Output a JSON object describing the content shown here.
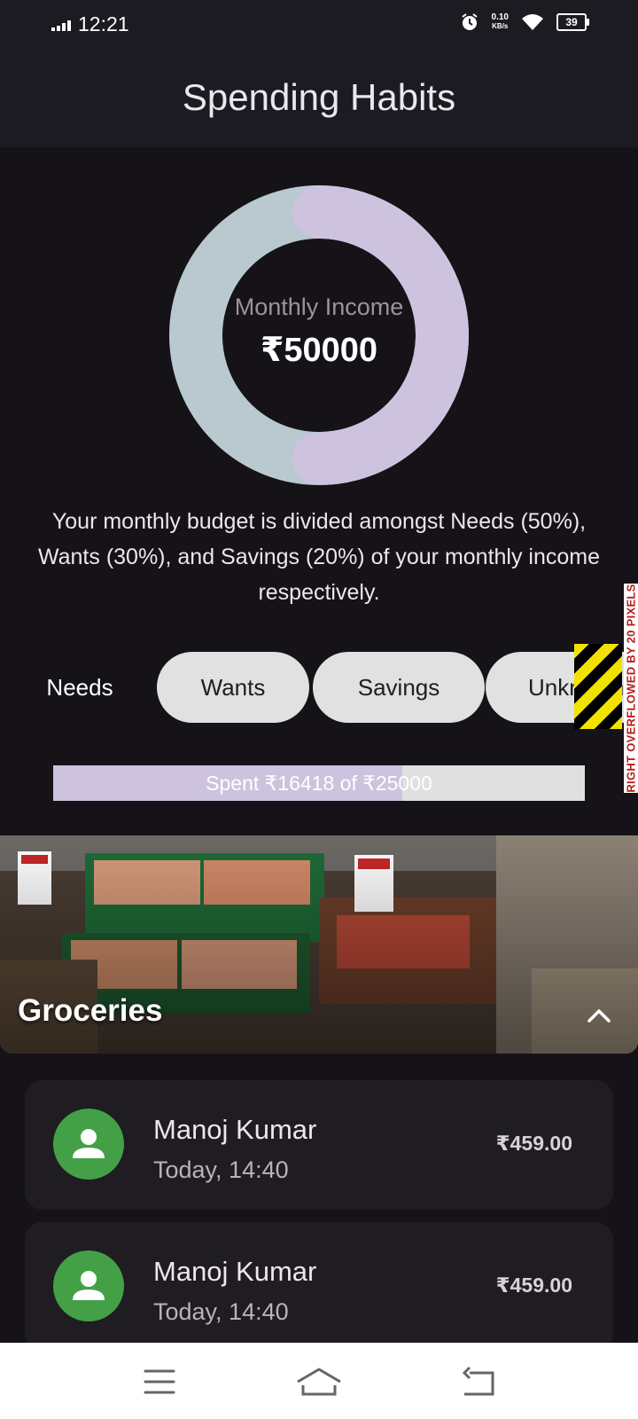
{
  "status_bar": {
    "time": "12:21",
    "net_speed_value": "0.10",
    "net_speed_unit": "KB/s",
    "battery": "39"
  },
  "app_bar": {
    "title": "Spending Habits"
  },
  "income_chart": {
    "label": "Monthly Income",
    "value": "₹50000",
    "segments": [
      {
        "color": "#cdc3de",
        "fraction": 0.5
      },
      {
        "color": "#b9c9cf",
        "fraction": 0.5
      }
    ]
  },
  "budget_description": "Your monthly budget is divided amongst Needs (50%), Wants (30%), and Savings (20%) of your monthly income respectively.",
  "categories": {
    "needs": "Needs",
    "wants": "Wants",
    "savings": "Savings",
    "unknown": "Unknown"
  },
  "overflow_warning": "RIGHT OVERFLOWED BY 20 PIXELS",
  "spend_progress": {
    "text": "Spent ₹16418 of ₹25000",
    "spent": 16418,
    "total": 25000
  },
  "category_banner": {
    "title": "Groceries"
  },
  "transactions": [
    {
      "name": "Manoj Kumar",
      "time": "Today, 14:40",
      "amount": "₹459.00"
    },
    {
      "name": "Manoj Kumar",
      "time": "Today, 14:40",
      "amount": "₹459.00"
    }
  ],
  "colors": {
    "background": "#151218",
    "app_bar": "#1d1b22",
    "accent": "#cdc3de",
    "avatar": "#43a047"
  }
}
